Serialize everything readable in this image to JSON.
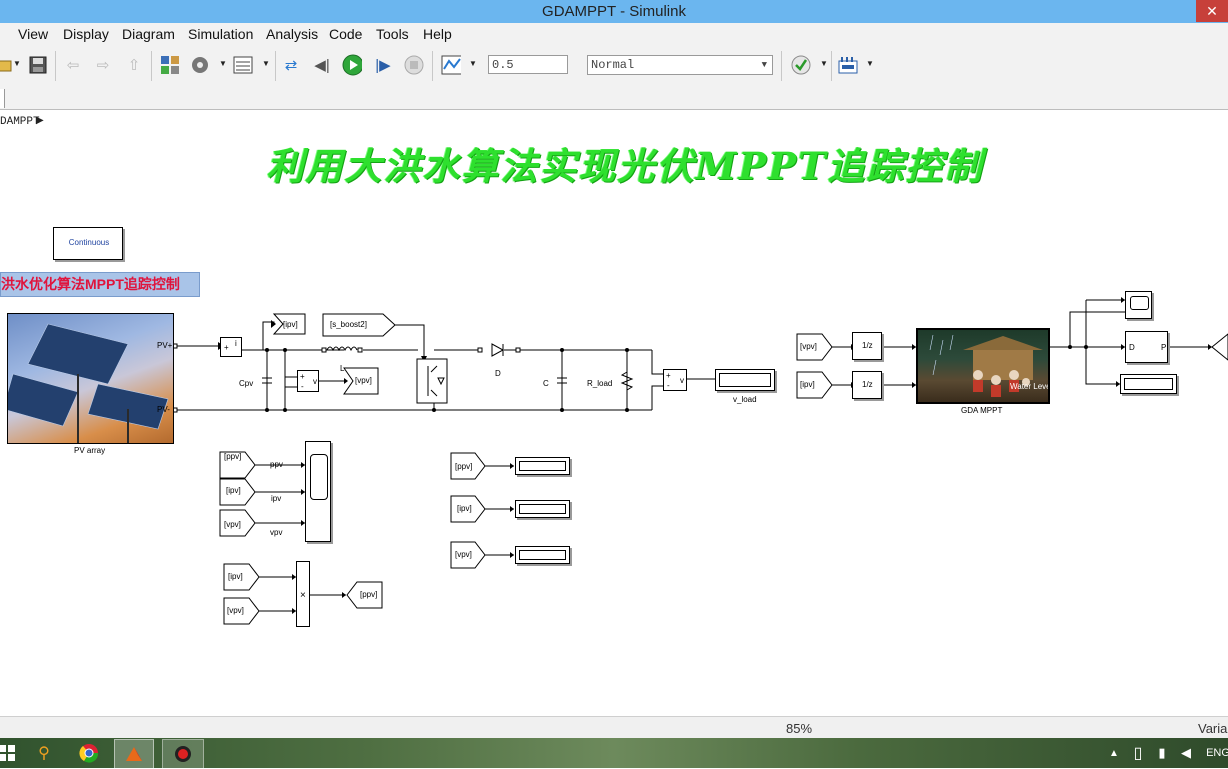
{
  "window": {
    "title": "GDAMPPT - Simulink",
    "close_glyph": "✕"
  },
  "menu": [
    "View",
    "Display",
    "Diagram",
    "Simulation",
    "Analysis",
    "Code",
    "Tools",
    "Help"
  ],
  "toolbar": {
    "stop_time": "0.5",
    "sim_mode": "Normal"
  },
  "breadcrumb": "DAMPPT",
  "diagram": {
    "title": "利用大洪水算法实现光伏MPPT追踪控制",
    "subtitle": "洪水优化算法MPPT追踪控制",
    "solver": "Continuous",
    "pv": {
      "label": "PV array",
      "port_plus": "PV+",
      "port_minus": "PV-"
    },
    "tags": {
      "ipv": "[ipv]",
      "vpv": "[vpv]",
      "ppv": "[ppv]",
      "s_boost2": "[s_boost2]",
      "vpv2": "[vpv]",
      "ipv2": "[ipv]",
      "ppv3": "[ppv]",
      "ipv3": "[ipv]",
      "vpv3": "[vpv]",
      "ppv4": "[ppv]",
      "ipv4": "[ipv]",
      "vpv4": "[vpv]",
      "ipv5": "[ipv]",
      "vpv5": "[vpv]",
      "ppv5": "[ppv]"
    },
    "components": {
      "cpv": "Cpv",
      "inductor": "L",
      "diode": "D",
      "cap": "C",
      "rload": "R_load",
      "vload": "v_load",
      "gda": "GDA MPPT",
      "gda_inner": "Water Level",
      "mux_ppv": "ppv",
      "mux_ipv": "ipv",
      "mux_vpv": "vpv",
      "unit_delay": "1/z",
      "pwm_d": "D",
      "pwm_p": "P",
      "product": "×",
      "plus": "+",
      "minus": "-",
      "meas": "v"
    }
  },
  "status": {
    "zoom": "85%",
    "right": "Varia"
  },
  "taskbar": {
    "lang": "ENG"
  },
  "colors": {
    "title_green": "#2ee02e",
    "subtitle_red": "#e0143c",
    "titlebar": "#6bb6ef"
  }
}
